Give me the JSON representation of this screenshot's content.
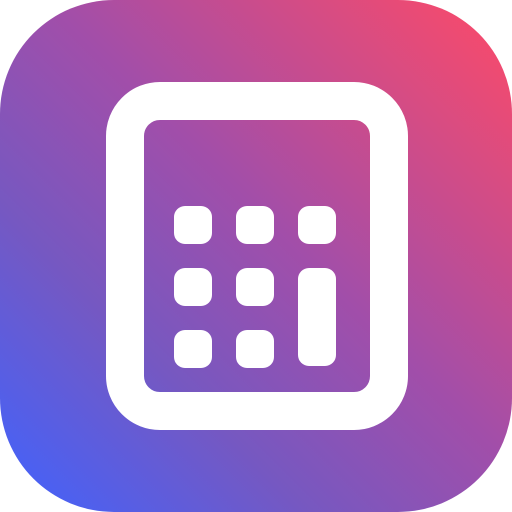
{
  "icon": {
    "name": "calculator-app-icon",
    "symbol": "calculator-icon",
    "colors": {
      "gradient_top_right": "#ff4a66",
      "gradient_bottom_left": "#3f63ff",
      "foreground": "#ffffff"
    }
  }
}
